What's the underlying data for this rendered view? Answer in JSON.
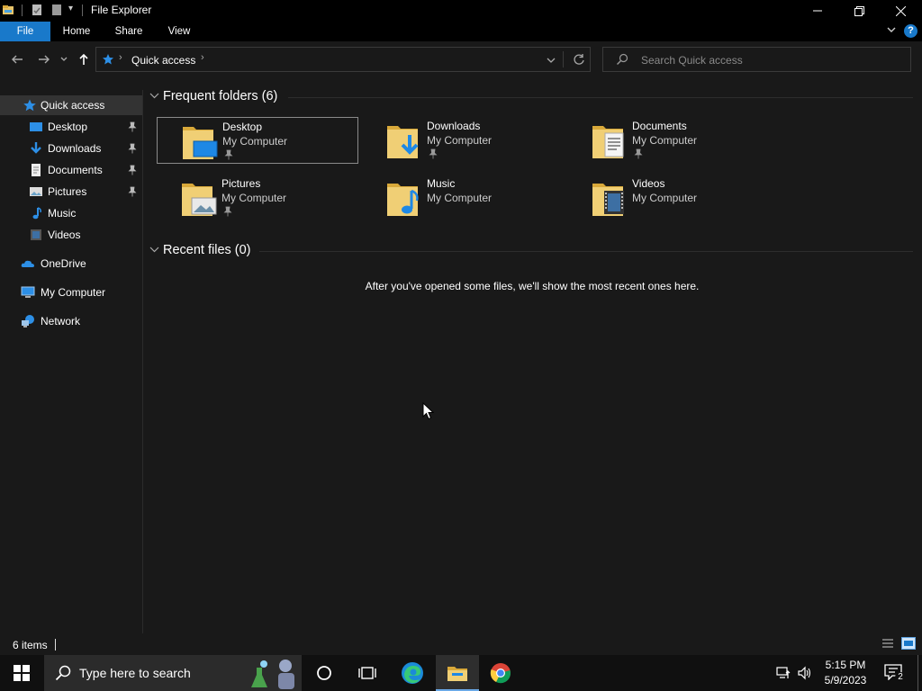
{
  "window": {
    "title": "File Explorer"
  },
  "ribbon": {
    "tabs": [
      "File",
      "Home",
      "Share",
      "View"
    ]
  },
  "address": {
    "path": "Quick access"
  },
  "search": {
    "placeholder": "Search Quick access"
  },
  "nav": {
    "items": [
      {
        "label": "Quick access",
        "icon": "star-icon"
      },
      {
        "label": "Desktop",
        "icon": "desktop-icon",
        "pinned": true
      },
      {
        "label": "Downloads",
        "icon": "download-icon",
        "pinned": true
      },
      {
        "label": "Documents",
        "icon": "documents-icon",
        "pinned": true
      },
      {
        "label": "Pictures",
        "icon": "pictures-icon",
        "pinned": true
      },
      {
        "label": "Music",
        "icon": "music-icon"
      },
      {
        "label": "Videos",
        "icon": "videos-icon"
      },
      {
        "label": "OneDrive",
        "icon": "onedrive-icon"
      },
      {
        "label": "My Computer",
        "icon": "computer-icon"
      },
      {
        "label": "Network",
        "icon": "network-icon"
      }
    ]
  },
  "frequent": {
    "heading": "Frequent folders (6)",
    "folders": [
      {
        "name": "Desktop",
        "location": "My Computer",
        "pinned": true
      },
      {
        "name": "Downloads",
        "location": "My Computer",
        "pinned": true
      },
      {
        "name": "Documents",
        "location": "My Computer",
        "pinned": true
      },
      {
        "name": "Pictures",
        "location": "My Computer",
        "pinned": true
      },
      {
        "name": "Music",
        "location": "My Computer",
        "pinned": false
      },
      {
        "name": "Videos",
        "location": "My Computer",
        "pinned": false
      }
    ]
  },
  "recent": {
    "heading": "Recent files (0)",
    "empty_message": "After you've opened some files, we'll show the most recent ones here."
  },
  "status": {
    "item_count": "6 items"
  },
  "taskbar": {
    "search_placeholder": "Type here to search",
    "time": "5:15 PM",
    "date": "5/9/2023",
    "notification_count": "2"
  },
  "colors": {
    "accent": "#1979ca",
    "folder": "#e8c46a",
    "background": "#191919"
  }
}
